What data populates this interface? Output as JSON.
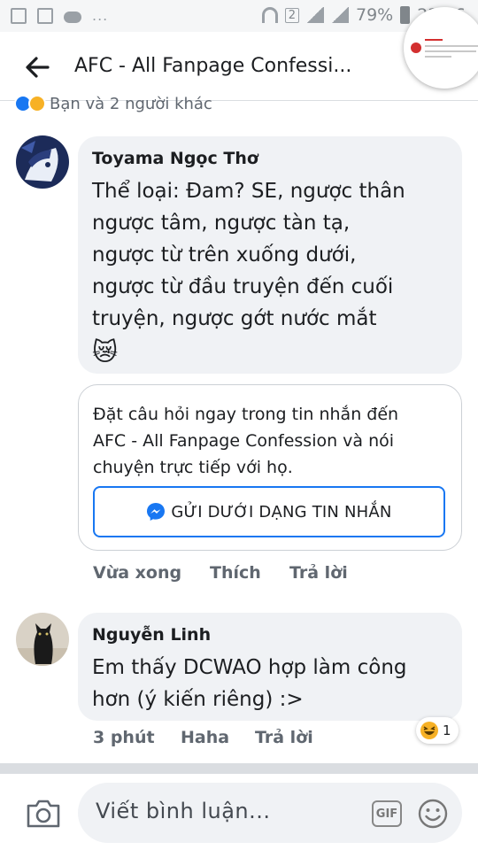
{
  "status_bar": {
    "overflow": "...",
    "sim_slot": "2",
    "battery": "79%",
    "time": "22:06"
  },
  "header": {
    "title": "AFC - All Fanpage Confessi...",
    "back_icon": "back-arrow-icon"
  },
  "post_reactions": {
    "summary": "Bạn và 2 người khác"
  },
  "comments": [
    {
      "author": "Toyama Ngọc Thơ",
      "lines": [
        "Thể loại: Đam? SE, ngược thân",
        "ngược tâm, ngược tàn tạ,",
        "ngược từ trên xuống dưới,",
        "ngược từ đầu truyện đến cuối",
        "truyện, ngược gớt nước mắt"
      ],
      "emoji": "😿",
      "share_card": {
        "text_lines": [
          "Đặt câu hỏi ngay trong tin nhắn đến",
          "AFC - All Fanpage Confession và nói",
          "chuyện trực tiếp với họ."
        ],
        "button_label": "GỬI DƯỚI DẠNG TIN NHẮN"
      },
      "actions": {
        "time": "Vừa xong",
        "like": "Thích",
        "reply": "Trả lời"
      }
    },
    {
      "author": "Nguyễn Linh",
      "lines": [
        "Em thấy DCWAO hợp làm công",
        "hơn (ý kiến riêng) :>"
      ],
      "actions": {
        "time": "3 phút",
        "like": "Haha",
        "reply": "Trả lời"
      },
      "reaction_count": "1"
    }
  ],
  "composer": {
    "placeholder": "Viết bình luận...",
    "gif_label": "GIF"
  },
  "colors": {
    "accent": "#1877f2",
    "bubble": "#f0f2f5",
    "secondary_text": "#606770"
  }
}
